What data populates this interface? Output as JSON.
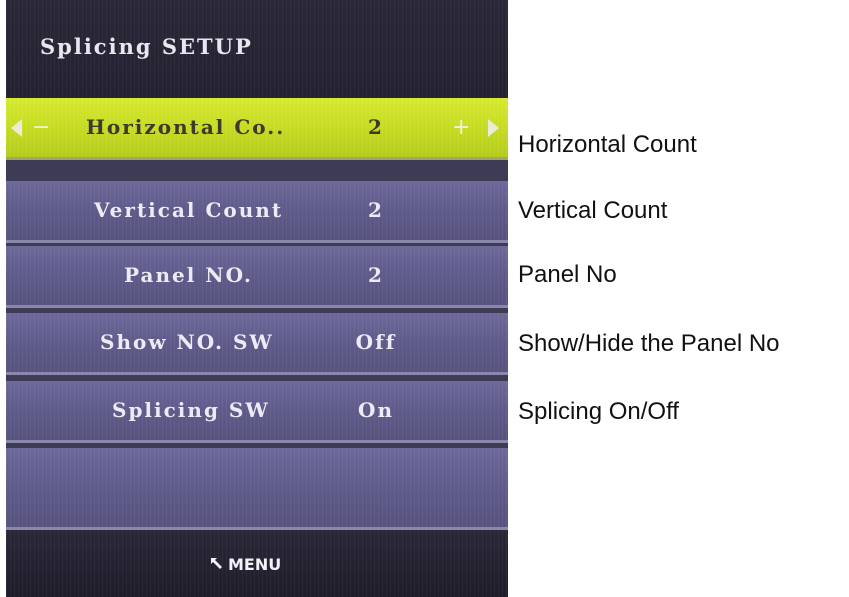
{
  "osd": {
    "title": "Splicing SETUP",
    "rows": [
      {
        "label": "Horizontal Co..",
        "value": "2",
        "selected": true,
        "minus": "−",
        "plus": "+"
      },
      {
        "label": "Vertical Count",
        "value": "2",
        "selected": false
      },
      {
        "label": "Panel NO.",
        "value": "2",
        "selected": false
      },
      {
        "label": "Show NO. SW",
        "value": "Off",
        "selected": false
      },
      {
        "label": "Splicing SW",
        "value": "On",
        "selected": false
      }
    ],
    "footer": {
      "menu_label": "MENU",
      "menu_icon": "return-arrow-icon"
    },
    "colors": {
      "selected_row": "#c6dc1f",
      "row": "#5e5a8a",
      "header": "#262433",
      "text": "#ecebf5"
    }
  },
  "annotations": [
    "Horizontal Count",
    "Vertical Count",
    "Panel No",
    "Show/Hide the Panel No",
    "Splicing On/Off"
  ]
}
